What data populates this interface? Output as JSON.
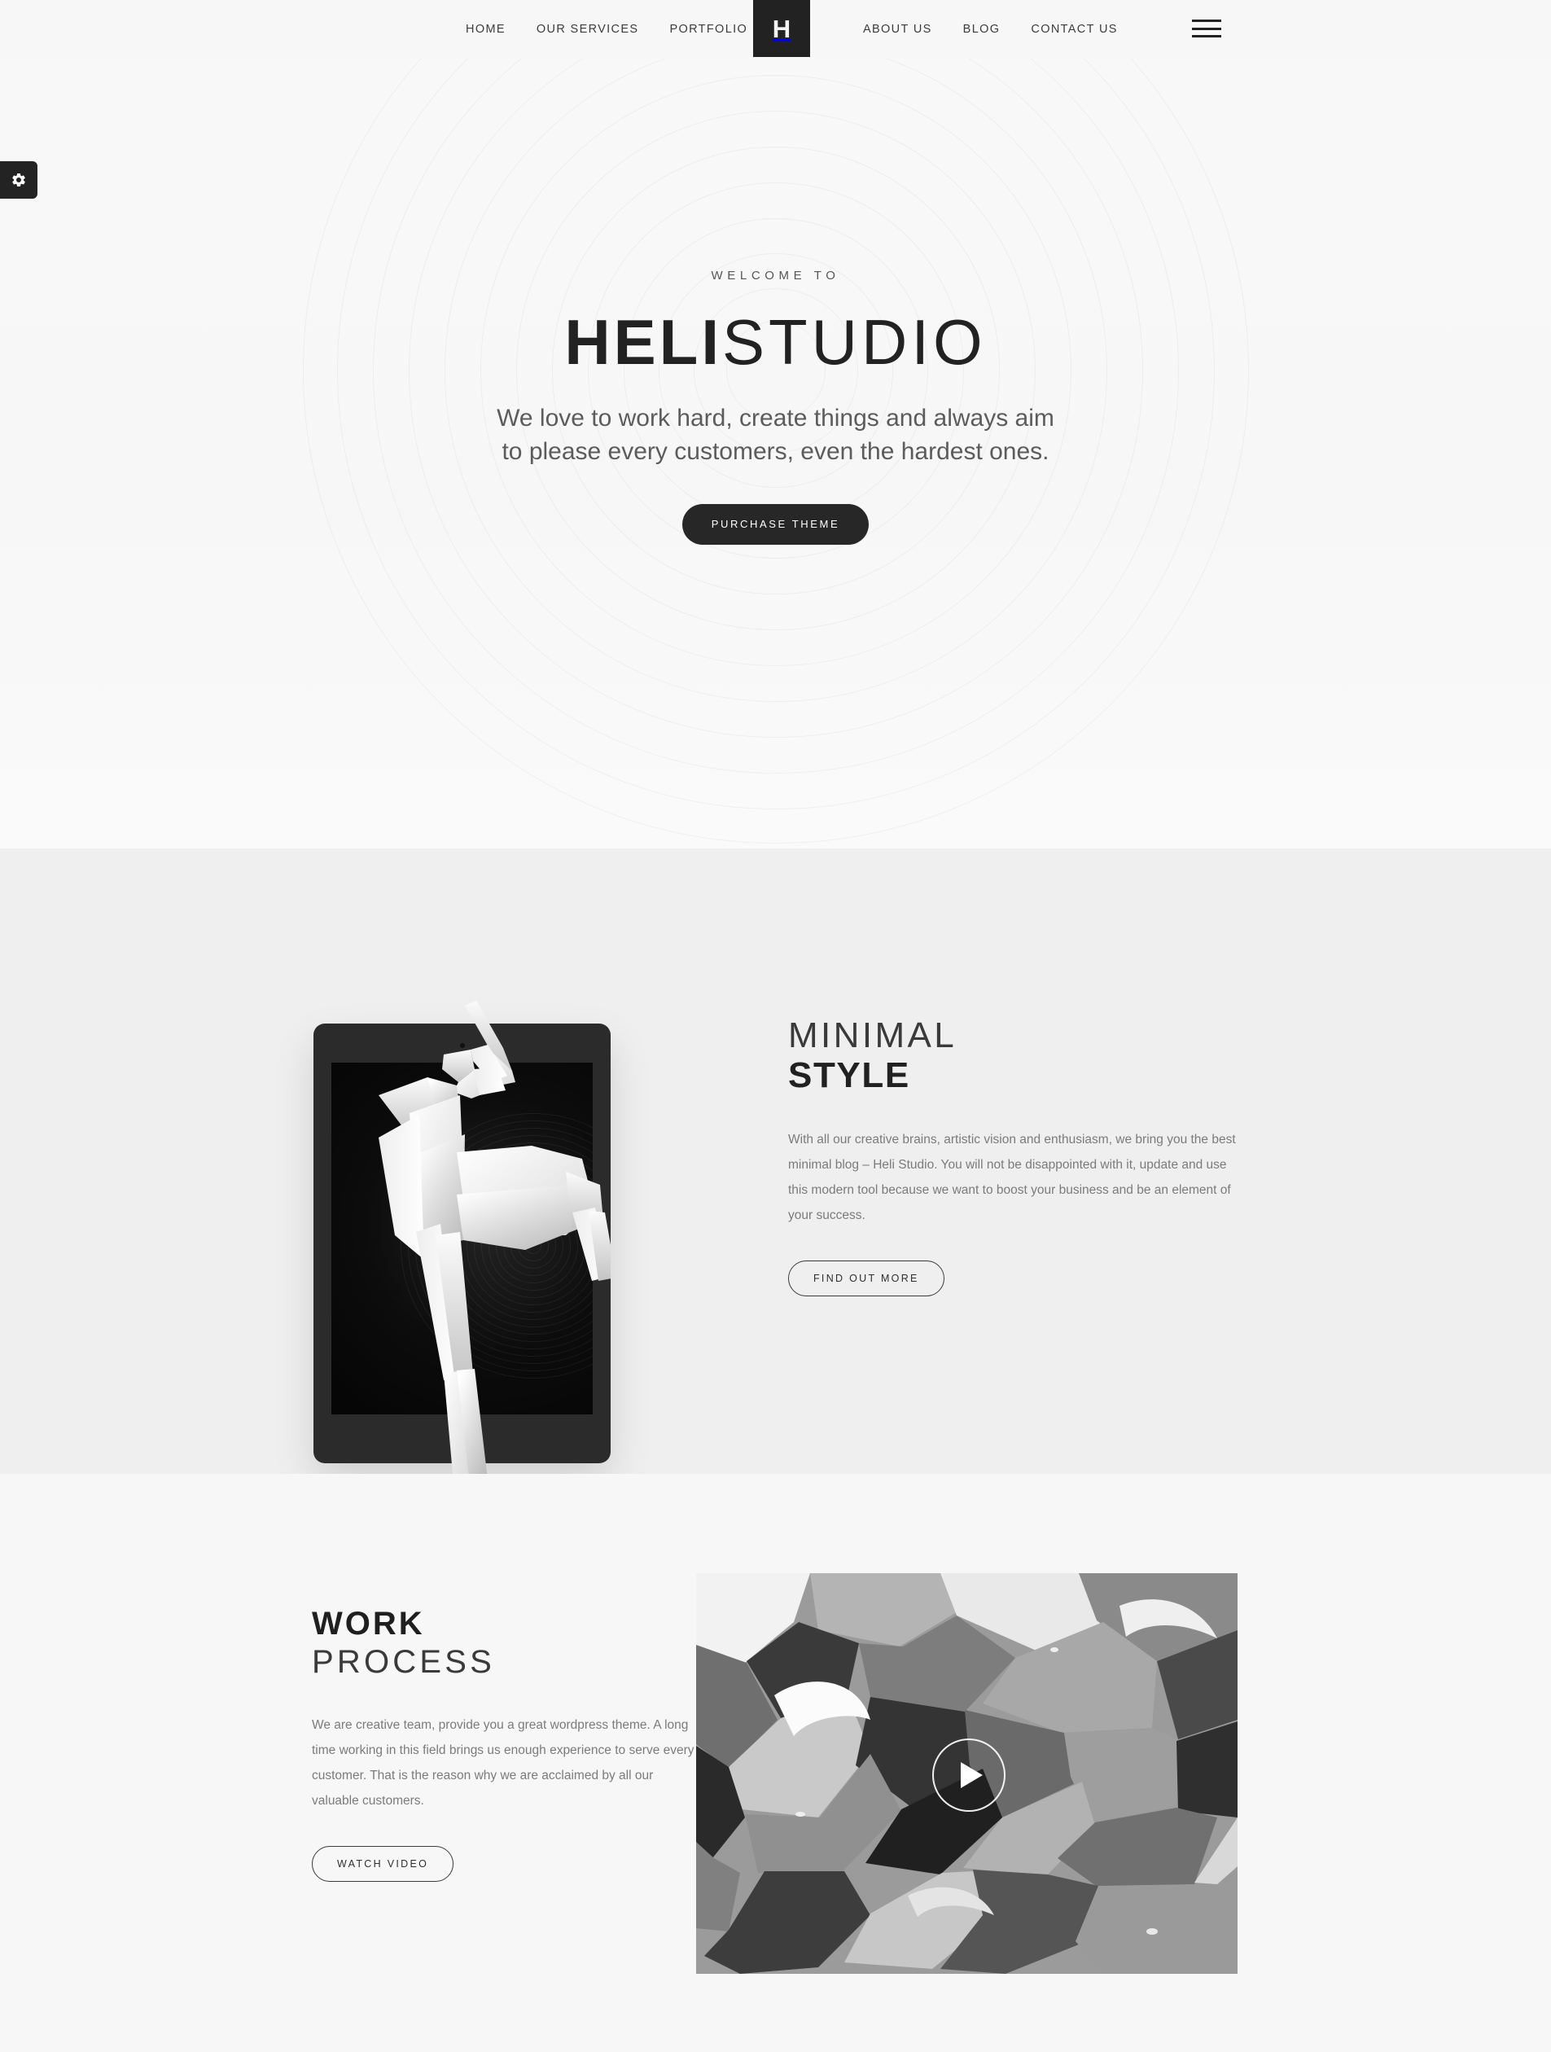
{
  "colors": {
    "dark": "#222222",
    "page_bg": "#f7f7f7",
    "alt_section_bg": "#efefef",
    "body_text": "#7b7b7b"
  },
  "header": {
    "logo_letter": "H",
    "nav_left": [
      {
        "label": "HOME"
      },
      {
        "label": "OUR SERVICES"
      },
      {
        "label": "PORTFOLIO"
      }
    ],
    "nav_right": [
      {
        "label": "ABOUT US"
      },
      {
        "label": "BLOG"
      },
      {
        "label": "CONTACT US"
      }
    ],
    "menu_icon": "hamburger-icon"
  },
  "settings_tab": {
    "icon": "gear-icon"
  },
  "hero": {
    "welcome": "WELCOME TO",
    "title_bold": "HELI",
    "title_thin": "STUDIO",
    "subtitle": "We love to work hard, create things and always aim to please every customers, even the hardest ones.",
    "cta_label": "PURCHASE THEME"
  },
  "style_section": {
    "heading_thin": "MINIMAL",
    "heading_bold": "STYLE",
    "paragraph": "With all our creative brains, artistic vision and enthusiasm, we bring you the best minimal blog – Heli Studio. You will not be disappointed with it, update and use this modern tool because we want to boost your business and be an element of your success.",
    "cta_label": "FIND OUT MORE",
    "image_alt": "origami-deer-tablet-image"
  },
  "work_section": {
    "heading_bold": "WORK",
    "heading_thin": "PROCESS",
    "paragraph": "We are creative team, provide you a great wordpress theme. A long time working in this field brings us enough experience to serve every customer. That is the reason why we are acclaimed by all our valuable customers.",
    "cta_label": "WATCH VIDEO",
    "video_alt": "marbled-ink-video-thumbnail",
    "play_icon": "play-icon"
  }
}
